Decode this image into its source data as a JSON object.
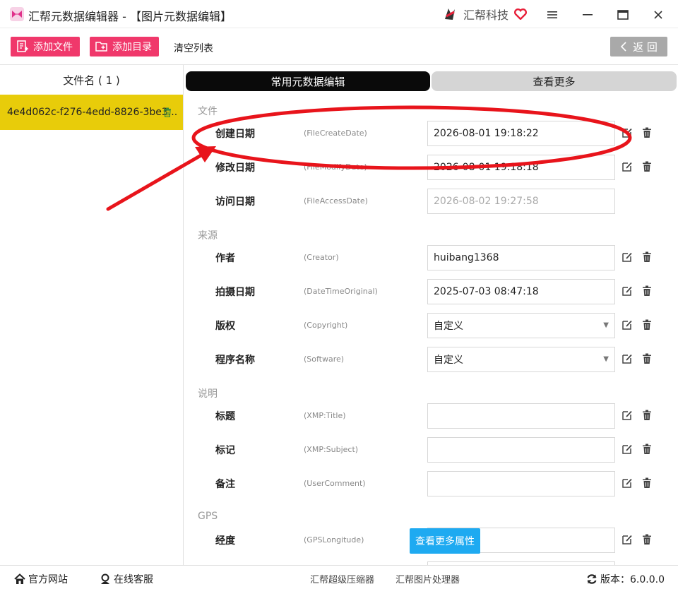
{
  "window": {
    "title": "汇帮元数据编辑器 - 【图片元数据编辑】",
    "brand": "汇帮科技",
    "brand_color": "#e8203a"
  },
  "toolbar": {
    "add_file": "添加文件",
    "add_folder": "添加目录",
    "clear_list": "清空列表",
    "back": "返 回",
    "accent": "#f0386b"
  },
  "sidebar": {
    "header": "文件名 ( 1 )",
    "files": [
      "4e4d062c-f276-4edd-8826-3be3..."
    ]
  },
  "tabs": {
    "common": "常用元数据编辑",
    "more": "查看更多"
  },
  "sections": {
    "file": "文件",
    "source": "来源",
    "description": "说明",
    "gps": "GPS"
  },
  "fields": {
    "create": {
      "label": "创建日期",
      "key": "(FileCreateDate)",
      "value": "2026-08-01 19:18:22"
    },
    "modify": {
      "label": "修改日期",
      "key": "(FileModifyDate)",
      "value": "2026-08-01 19:18:18"
    },
    "access": {
      "label": "访问日期",
      "key": "(FileAccessDate)",
      "value": "2026-08-02 19:27:58"
    },
    "creator": {
      "label": "作者",
      "key": "(Creator)",
      "value": "huibang1368"
    },
    "datetime": {
      "label": "拍摄日期",
      "key": "(DateTimeOriginal)",
      "value": "2025-07-03 08:47:18"
    },
    "copyright": {
      "label": "版权",
      "key": "(Copyright)",
      "value": "自定义"
    },
    "software": {
      "label": "程序名称",
      "key": "(Software)",
      "value": "自定义"
    },
    "title": {
      "label": "标题",
      "key": "(XMP:Title)",
      "value": ""
    },
    "subject": {
      "label": "标记",
      "key": "(XMP:Subject)",
      "value": ""
    },
    "comment": {
      "label": "备注",
      "key": "(UserComment)",
      "value": ""
    },
    "longitude": {
      "label": "经度",
      "key": "(GPSLongitude)",
      "value": ""
    }
  },
  "more_props_button": "查看更多属性",
  "statusbar": {
    "website": "官方网站",
    "support": "在线客服",
    "compressor": "汇帮超级压缩器",
    "image_tool": "汇帮图片处理器",
    "version": "版本：6.0.0.0"
  },
  "annotation_color": "#e8141b",
  "icons": [
    "app-logo-icon",
    "brand-logo-icon",
    "heart-icon",
    "menu-icon",
    "minimize-icon",
    "maximize-icon",
    "close-icon",
    "add-file-icon",
    "add-folder-icon",
    "chevron-left-icon",
    "trash-icon",
    "edit-icon",
    "home-icon",
    "support-icon",
    "refresh-icon"
  ]
}
